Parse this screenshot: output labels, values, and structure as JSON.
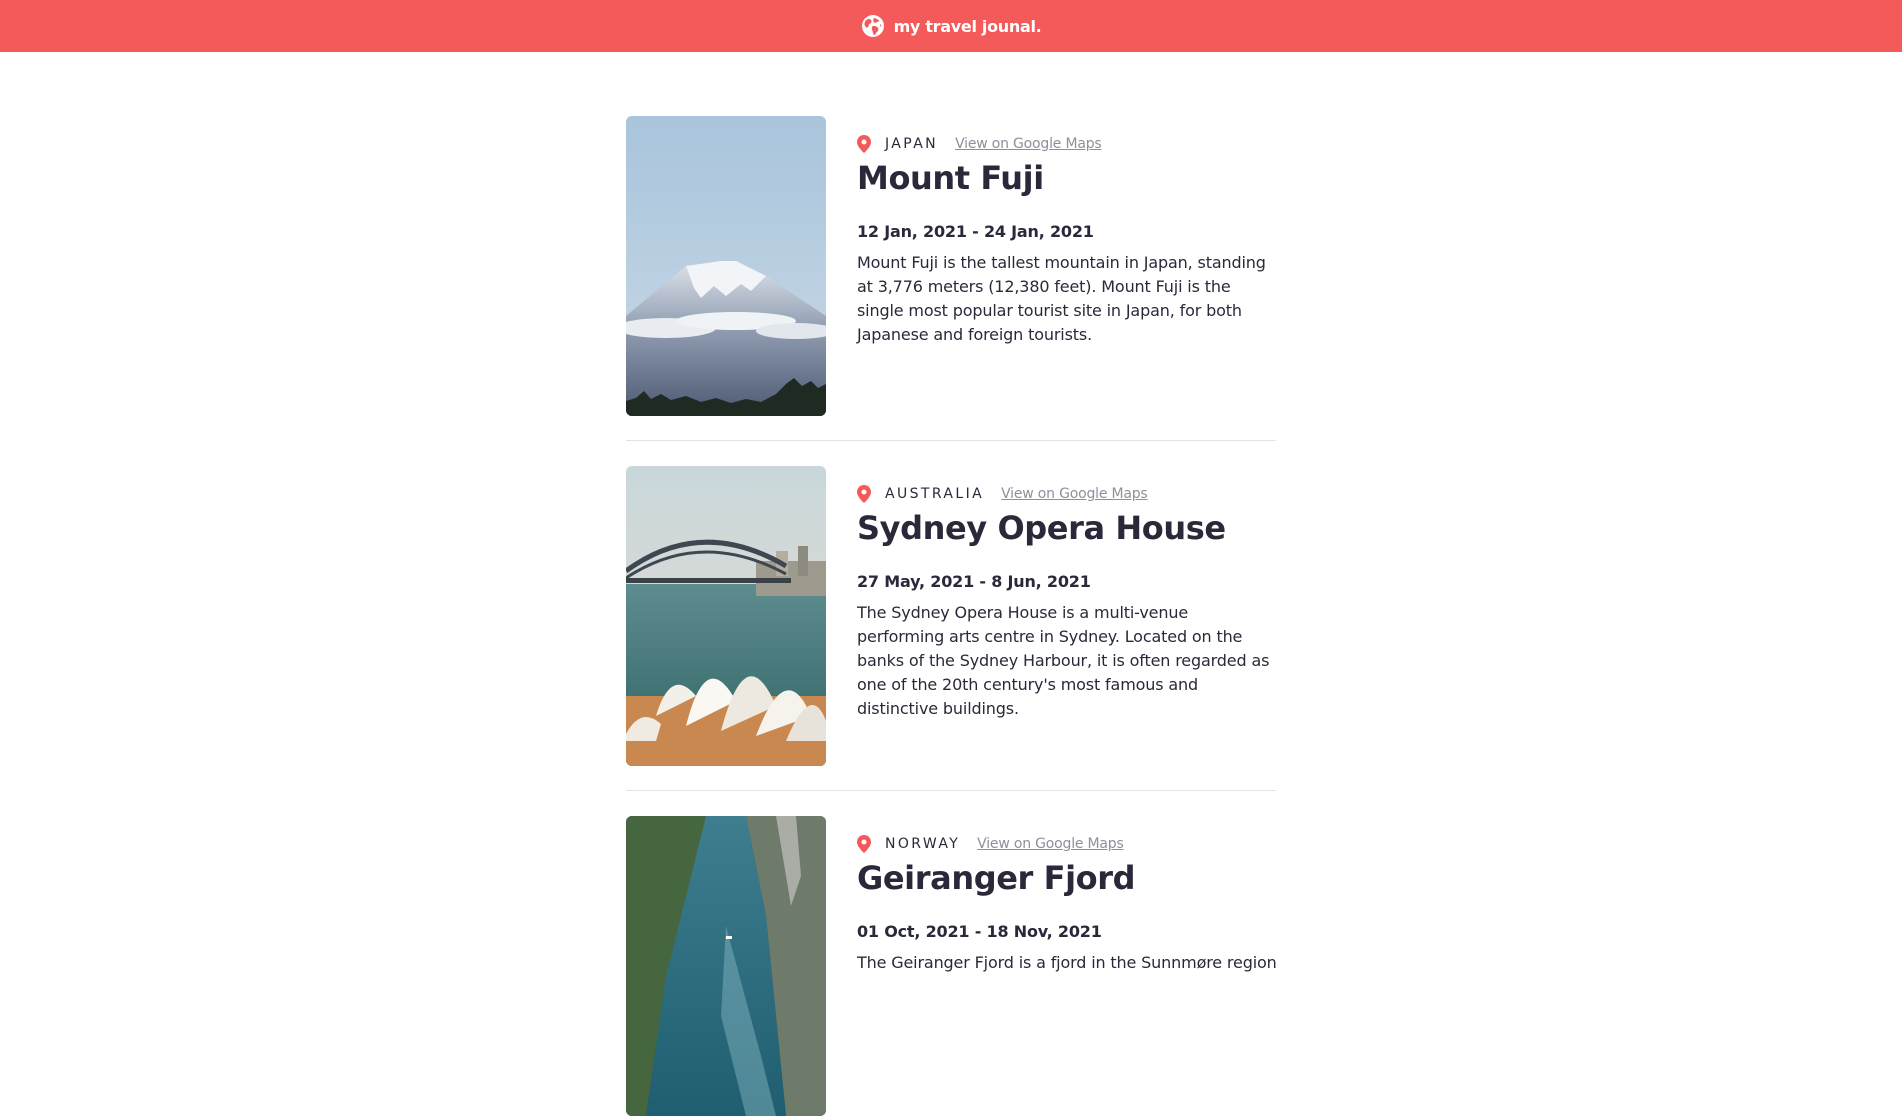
{
  "header": {
    "title": "my travel jounal.",
    "icon": "globe-icon",
    "background": "#F55A5A"
  },
  "entries": [
    {
      "country": "JAPAN",
      "map_link": "View on Google Maps",
      "title": "Mount Fuji",
      "dates": "12 Jan, 2021 - 24 Jan, 2021",
      "description": "Mount Fuji is the tallest mountain in Japan, standing at 3,776 meters (12,380 feet). Mount Fuji is the single most popular tourist site in Japan, for both Japanese and foreign tourists."
    },
    {
      "country": "AUSTRALIA",
      "map_link": "View on Google Maps",
      "title": "Sydney Opera House",
      "dates": "27 May, 2021 - 8 Jun, 2021",
      "description": "The Sydney Opera House is a multi-venue performing arts centre in Sydney. Located on the banks of the Sydney Harbour, it is often regarded as one of the 20th century's most famous and distinctive buildings."
    },
    {
      "country": "NORWAY",
      "map_link": "View on Google Maps",
      "title": "Geiranger Fjord",
      "dates": "01 Oct, 2021 - 18 Nov, 2021",
      "description": "The Geiranger Fjord is a fjord in the Sunnmøre region"
    }
  ],
  "colors": {
    "accent": "#F55A5A",
    "text": "#2B283A",
    "link": "#918E9B",
    "divider": "#E3E3E3"
  }
}
